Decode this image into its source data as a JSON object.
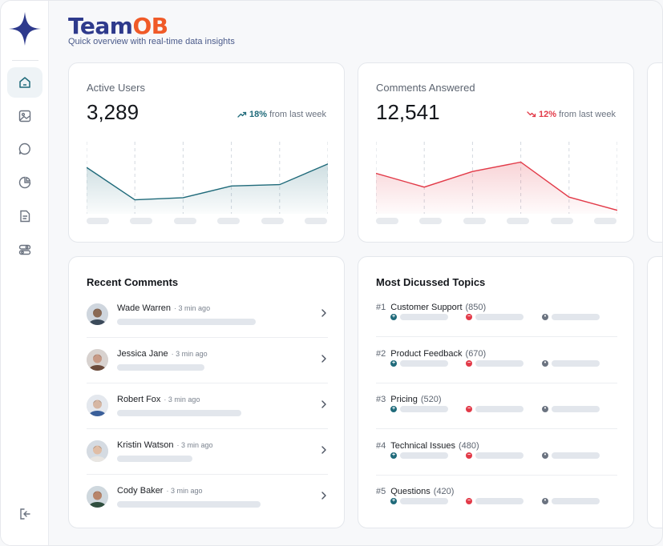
{
  "app": {
    "brand_prefix": "Team",
    "brand_suffix": "OB",
    "subtitle": "Quick overview with real-time data insights"
  },
  "colors": {
    "brand_blue": "#2e3a8c",
    "brand_orange": "#f05a28",
    "teal": "#1f6a7a",
    "red": "#e23a48",
    "grey": "#6b7380"
  },
  "sidebar": {
    "items": [
      {
        "icon": "home-icon",
        "active": true
      },
      {
        "icon": "image-icon",
        "active": false
      },
      {
        "icon": "chat-icon",
        "active": false
      },
      {
        "icon": "pie-chart-icon",
        "active": false
      },
      {
        "icon": "document-icon",
        "active": false
      },
      {
        "icon": "toggle-icon",
        "active": false
      }
    ],
    "logout_icon": "logout-icon"
  },
  "stats": [
    {
      "label": "Active Users",
      "value": "3,289",
      "change": "18%",
      "change_suffix": "from last week",
      "direction": "up"
    },
    {
      "label": "Comments Answered",
      "value": "12,541",
      "change": "12%",
      "change_suffix": "from last week",
      "direction": "down"
    }
  ],
  "chart_data": [
    {
      "type": "area",
      "x": [
        0,
        1,
        2,
        3,
        4,
        5
      ],
      "values": [
        65,
        18,
        21,
        38,
        40,
        70
      ],
      "ylim": [
        0,
        100
      ],
      "grid": true
    },
    {
      "type": "area",
      "x": [
        0,
        1,
        2,
        3,
        4,
        5
      ],
      "values": [
        52,
        30,
        55,
        70,
        14,
        -7
      ],
      "ylim": [
        -10,
        100
      ],
      "grid": true
    }
  ],
  "recent_comments": {
    "title": "Recent Comments",
    "items": [
      {
        "name": "Wade Warren",
        "time": "3 min ago",
        "progress": 0.7
      },
      {
        "name": "Jessica Jane",
        "time": "3 min ago",
        "progress": 0.49
      },
      {
        "name": "Robert Fox",
        "time": "3 min ago",
        "progress": 0.64
      },
      {
        "name": "Kristin Watson",
        "time": "3 min ago",
        "progress": 0.44
      },
      {
        "name": "Cody Baker",
        "time": "3 min ago",
        "progress": 0.72
      }
    ]
  },
  "topics": {
    "title": "Most Dicussed Topics",
    "items": [
      {
        "rank": "#1",
        "name": "Customer Support",
        "count": "(850)"
      },
      {
        "rank": "#2",
        "name": "Product Feedback",
        "count": "(670)"
      },
      {
        "rank": "#3",
        "name": "Pricing",
        "count": "(520)"
      },
      {
        "rank": "#4",
        "name": "Technical Issues",
        "count": "(480)"
      },
      {
        "rank": "#5",
        "name": "Questions",
        "count": "(420)"
      }
    ]
  }
}
